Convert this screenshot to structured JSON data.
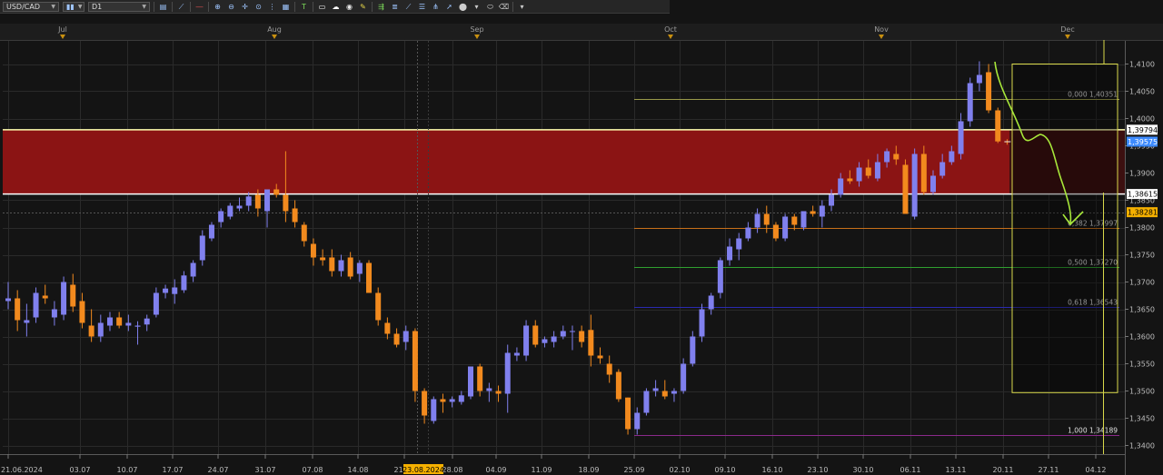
{
  "toolbar": {
    "symbol": "USD/CAD",
    "chart_type_icon": "candlestick-icon",
    "timeframe": "D1",
    "icons": [
      "bar-chart-icon",
      "line-tool-icon",
      "horizontal-line-icon",
      "zoom-in-icon",
      "zoom-out-icon",
      "crosshair-icon",
      "text-tool-icon",
      "note-icon",
      "cloud-icon",
      "pencil-icon",
      "channel-icon",
      "fibonacci-icon",
      "grid-icon",
      "ellipse-icon",
      "eraser-icon",
      "settings-icon"
    ]
  },
  "chart_data": {
    "type": "candlestick",
    "symbol": "USD/CAD",
    "timeframe": "D1",
    "ylim": [
      1.339,
      1.413
    ],
    "y_ticks": [
      "1,4100",
      "1,4050",
      "1,4000",
      "1,3950",
      "1,3900",
      "1,3850",
      "1,3800",
      "1,3750",
      "1,3700",
      "1,3650",
      "1,3600",
      "1,3550",
      "1,3500",
      "1,3450",
      "1,3400"
    ],
    "month_labels": [
      "Jul",
      "Aug",
      "Sep",
      "Oct",
      "Nov",
      "Dec"
    ],
    "x_labels": [
      "21.06.2024",
      "03.07",
      "10.07",
      "17.07",
      "24.07",
      "31.07",
      "07.08",
      "14.08",
      "21.08",
      "28.08",
      "04.09",
      "11.09",
      "18.09",
      "25.09",
      "02.10",
      "09.10",
      "16.10",
      "23.10",
      "30.10",
      "06.11",
      "13.11",
      "20.11",
      "27.11",
      "04.12"
    ],
    "crosshair_date": "23.08.2024",
    "price_labels": [
      {
        "text": "1,39794",
        "value": 1.39794,
        "type": "level"
      },
      {
        "text": "1,39575",
        "value": 1.39575,
        "type": "current"
      },
      {
        "text": "1,38615",
        "value": 1.38615,
        "type": "level"
      },
      {
        "text": "1,38281",
        "value": 1.38281,
        "type": "crosshair"
      }
    ],
    "resistance_zone": {
      "top": 1.39794,
      "bottom": 1.38615,
      "color": "#8b1414"
    },
    "fibonacci": [
      {
        "label": "0,000 1,40351",
        "value": 1.40351,
        "color": "#9a9a4a"
      },
      {
        "label": "0,382 1,37997",
        "value": 1.37997,
        "color": "#c8701a"
      },
      {
        "label": "0,500 1,37270",
        "value": 1.3727,
        "color": "#2fa02f"
      },
      {
        "label": "0,618 1,36543",
        "value": 1.36543,
        "color": "#2a2ab0"
      },
      {
        "label": "1,000 1,34189",
        "value": 1.34189,
        "color": "#8a2a8a"
      }
    ],
    "projection_box": {
      "top": 1.41,
      "bottom": 1.3497,
      "color": "#d8d84a"
    },
    "colors": {
      "bull": "#8080ee",
      "bear": "#f28a1e",
      "background": "#141414",
      "grid": "#2a2a2a",
      "annotation": "#a8e83a"
    },
    "candles": [
      [
        1.3665,
        1.37,
        1.365,
        1.367
      ],
      [
        1.367,
        1.3685,
        1.361,
        1.363
      ],
      [
        1.3625,
        1.366,
        1.36,
        1.363
      ],
      [
        1.3635,
        1.369,
        1.3625,
        1.368
      ],
      [
        1.3675,
        1.3695,
        1.366,
        1.367
      ],
      [
        1.3635,
        1.3665,
        1.362,
        1.365
      ],
      [
        1.364,
        1.371,
        1.363,
        1.37
      ],
      [
        1.3695,
        1.3715,
        1.3645,
        1.3655
      ],
      [
        1.3665,
        1.368,
        1.3615,
        1.3625
      ],
      [
        1.362,
        1.365,
        1.359,
        1.36
      ],
      [
        1.36,
        1.364,
        1.359,
        1.3625
      ],
      [
        1.362,
        1.3645,
        1.361,
        1.3635
      ],
      [
        1.3635,
        1.3645,
        1.3615,
        1.362
      ],
      [
        1.362,
        1.364,
        1.361,
        1.3625
      ],
      [
        1.3618,
        1.3628,
        1.3585,
        1.362
      ],
      [
        1.3622,
        1.364,
        1.361,
        1.3633
      ],
      [
        1.364,
        1.369,
        1.3635,
        1.368
      ],
      [
        1.368,
        1.3695,
        1.367,
        1.3688
      ],
      [
        1.3678,
        1.3705,
        1.366,
        1.369
      ],
      [
        1.3685,
        1.372,
        1.368,
        1.3712
      ],
      [
        1.371,
        1.374,
        1.37,
        1.3735
      ],
      [
        1.374,
        1.3795,
        1.373,
        1.3785
      ],
      [
        1.378,
        1.381,
        1.3775,
        1.3805
      ],
      [
        1.381,
        1.3835,
        1.38,
        1.383
      ],
      [
        1.382,
        1.3845,
        1.3815,
        1.384
      ],
      [
        1.3835,
        1.3855,
        1.383,
        1.384
      ],
      [
        1.384,
        1.3865,
        1.383,
        1.3857
      ],
      [
        1.386,
        1.387,
        1.382,
        1.3835
      ],
      [
        1.383,
        1.387,
        1.38,
        1.387
      ],
      [
        1.387,
        1.388,
        1.3855,
        1.386
      ],
      [
        1.386,
        1.394,
        1.381,
        1.383
      ],
      [
        1.3835,
        1.385,
        1.38,
        1.381
      ],
      [
        1.3805,
        1.381,
        1.3765,
        1.3775
      ],
      [
        1.377,
        1.378,
        1.373,
        1.3745
      ],
      [
        1.3745,
        1.376,
        1.373,
        1.374
      ],
      [
        1.3745,
        1.376,
        1.371,
        1.372
      ],
      [
        1.372,
        1.375,
        1.371,
        1.374
      ],
      [
        1.3745,
        1.3755,
        1.3705,
        1.371
      ],
      [
        1.3715,
        1.374,
        1.37,
        1.3735
      ],
      [
        1.3735,
        1.374,
        1.368,
        1.368
      ],
      [
        1.368,
        1.369,
        1.362,
        1.363
      ],
      [
        1.3625,
        1.3635,
        1.3595,
        1.3605
      ],
      [
        1.3605,
        1.3615,
        1.358,
        1.3585
      ],
      [
        1.359,
        1.362,
        1.3575,
        1.361
      ],
      [
        1.361,
        1.3615,
        1.348,
        1.35
      ],
      [
        1.35,
        1.3505,
        1.344,
        1.3455
      ],
      [
        1.3445,
        1.349,
        1.344,
        1.3485
      ],
      [
        1.3485,
        1.3495,
        1.346,
        1.348
      ],
      [
        1.348,
        1.349,
        1.347,
        1.3485
      ],
      [
        1.348,
        1.35,
        1.3475,
        1.3492
      ],
      [
        1.349,
        1.3545,
        1.3485,
        1.3545
      ],
      [
        1.3545,
        1.355,
        1.349,
        1.35
      ],
      [
        1.35,
        1.3515,
        1.348,
        1.3505
      ],
      [
        1.35,
        1.351,
        1.348,
        1.3495
      ],
      [
        1.3495,
        1.3585,
        1.346,
        1.357
      ],
      [
        1.3565,
        1.358,
        1.3555,
        1.357
      ],
      [
        1.3565,
        1.363,
        1.3555,
        1.362
      ],
      [
        1.362,
        1.363,
        1.358,
        1.3585
      ],
      [
        1.3588,
        1.36,
        1.358,
        1.3595
      ],
      [
        1.359,
        1.361,
        1.358,
        1.36
      ],
      [
        1.36,
        1.362,
        1.3595,
        1.361
      ],
      [
        1.361,
        1.362,
        1.3575,
        1.361
      ],
      [
        1.361,
        1.362,
        1.358,
        1.359
      ],
      [
        1.3612,
        1.364,
        1.3545,
        1.3565
      ],
      [
        1.3565,
        1.358,
        1.355,
        1.356
      ],
      [
        1.355,
        1.3565,
        1.3515,
        1.353
      ],
      [
        1.3535,
        1.354,
        1.348,
        1.3485
      ],
      [
        1.3488,
        1.3488,
        1.342,
        1.343
      ],
      [
        1.343,
        1.347,
        1.342,
        1.346
      ],
      [
        1.346,
        1.3505,
        1.3455,
        1.35
      ],
      [
        1.35,
        1.352,
        1.349,
        1.3505
      ],
      [
        1.35,
        1.352,
        1.3485,
        1.349
      ],
      [
        1.3495,
        1.3505,
        1.348,
        1.35
      ],
      [
        1.35,
        1.356,
        1.3495,
        1.355
      ],
      [
        1.355,
        1.361,
        1.3545,
        1.36
      ],
      [
        1.36,
        1.366,
        1.359,
        1.365
      ],
      [
        1.365,
        1.368,
        1.364,
        1.3675
      ],
      [
        1.368,
        1.3745,
        1.367,
        1.374
      ],
      [
        1.374,
        1.378,
        1.373,
        1.3765
      ],
      [
        1.376,
        1.379,
        1.374,
        1.378
      ],
      [
        1.378,
        1.381,
        1.3775,
        1.38
      ],
      [
        1.38,
        1.3835,
        1.379,
        1.3825
      ],
      [
        1.3825,
        1.384,
        1.379,
        1.3805
      ],
      [
        1.3805,
        1.381,
        1.3775,
        1.378
      ],
      [
        1.378,
        1.3825,
        1.3775,
        1.382
      ],
      [
        1.382,
        1.3825,
        1.3795,
        1.3805
      ],
      [
        1.38,
        1.383,
        1.3795,
        1.383
      ],
      [
        1.383,
        1.384,
        1.382,
        1.3825
      ],
      [
        1.382,
        1.385,
        1.38,
        1.384
      ],
      [
        1.384,
        1.387,
        1.383,
        1.386
      ],
      [
        1.386,
        1.39,
        1.3855,
        1.389
      ],
      [
        1.389,
        1.3905,
        1.388,
        1.3885
      ],
      [
        1.3885,
        1.392,
        1.3875,
        1.391
      ],
      [
        1.391,
        1.3925,
        1.389,
        1.3895
      ],
      [
        1.389,
        1.3935,
        1.3885,
        1.392
      ],
      [
        1.392,
        1.3945,
        1.391,
        1.394
      ],
      [
        1.3935,
        1.395,
        1.3915,
        1.3925
      ],
      [
        1.3915,
        1.3925,
        1.3825,
        1.3825
      ],
      [
        1.382,
        1.3945,
        1.3815,
        1.3935
      ],
      [
        1.3935,
        1.395,
        1.386,
        1.3865
      ],
      [
        1.3865,
        1.3905,
        1.386,
        1.3895
      ],
      [
        1.3895,
        1.3935,
        1.389,
        1.392
      ],
      [
        1.392,
        1.395,
        1.3915,
        1.394
      ],
      [
        1.3935,
        1.401,
        1.3925,
        1.3995
      ],
      [
        1.3995,
        1.4075,
        1.3985,
        1.4065
      ],
      [
        1.4065,
        1.4105,
        1.405,
        1.408
      ],
      [
        1.4085,
        1.41,
        1.401,
        1.4015
      ],
      [
        1.4015,
        1.402,
        1.3955,
        1.3958
      ],
      [
        1.3958,
        1.3962,
        1.3952,
        1.3957
      ]
    ]
  }
}
